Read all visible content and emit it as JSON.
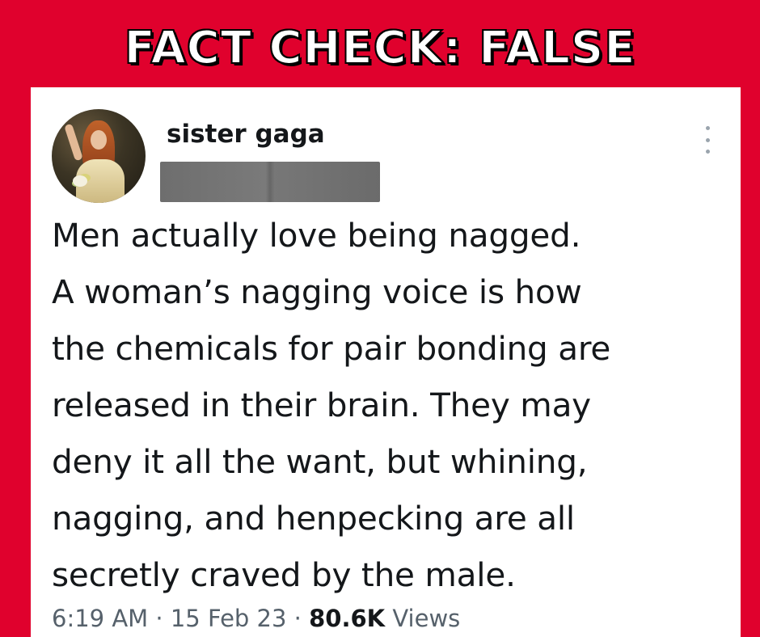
{
  "banner": {
    "text": "FACT CHECK: FALSE"
  },
  "tweet": {
    "username": "sister gaga",
    "text": "Men actually love being nagged.\nA woman’s nagging voice is how\nthe chemicals for pair bonding are\nreleased in their brain. They may\ndeny it all the want, but whining,\nnagging, and henpecking are all\nsecretly craved by the male.",
    "time": "6:19 AM",
    "separator": "·",
    "date": "15 Feb 23",
    "views_count": "80.6K",
    "views_label": "Views"
  },
  "icons": {
    "more": "more-vertical-icon"
  },
  "colors": {
    "background": "#e0012d",
    "card": "#ffffff",
    "text": "#14171a",
    "muted": "#56616b"
  }
}
